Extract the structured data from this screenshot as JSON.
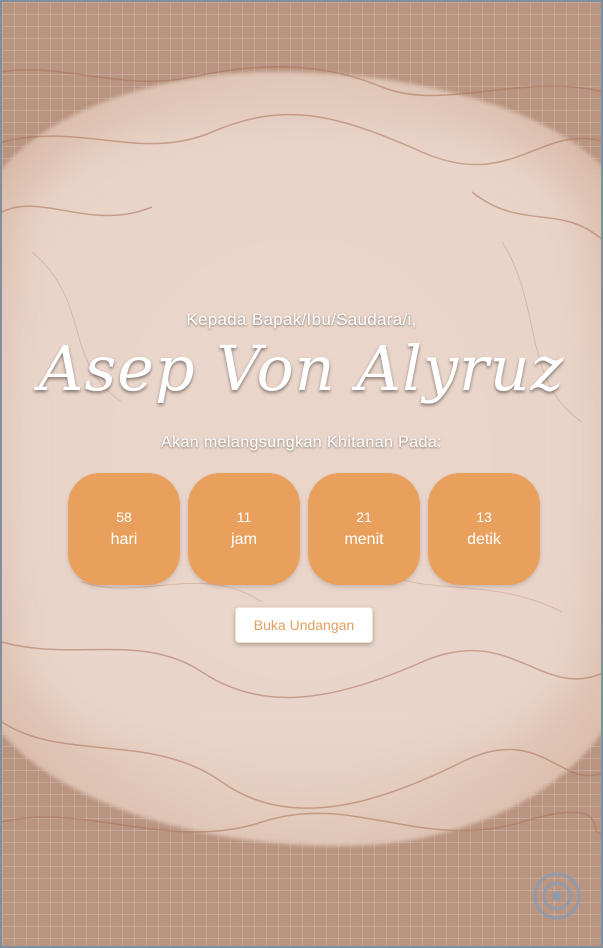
{
  "invitation": {
    "salutation": "Kepada Bapak/Ibu/Saudara/i,",
    "name": "Asep Von Alyruz",
    "subline": "Akan melangsungkan Khitanan Pada:",
    "open_button_label": "Buka Undangan"
  },
  "countdown": [
    {
      "value": "58",
      "unit": "hari"
    },
    {
      "value": "11",
      "unit": "jam"
    },
    {
      "value": "21",
      "unit": "menit"
    },
    {
      "value": "13",
      "unit": "detik"
    }
  ],
  "icons": {
    "music": "music-disc-icon"
  },
  "colors": {
    "tile": "#e9a05c",
    "button_text": "#e0a060",
    "background": "#b99480"
  }
}
